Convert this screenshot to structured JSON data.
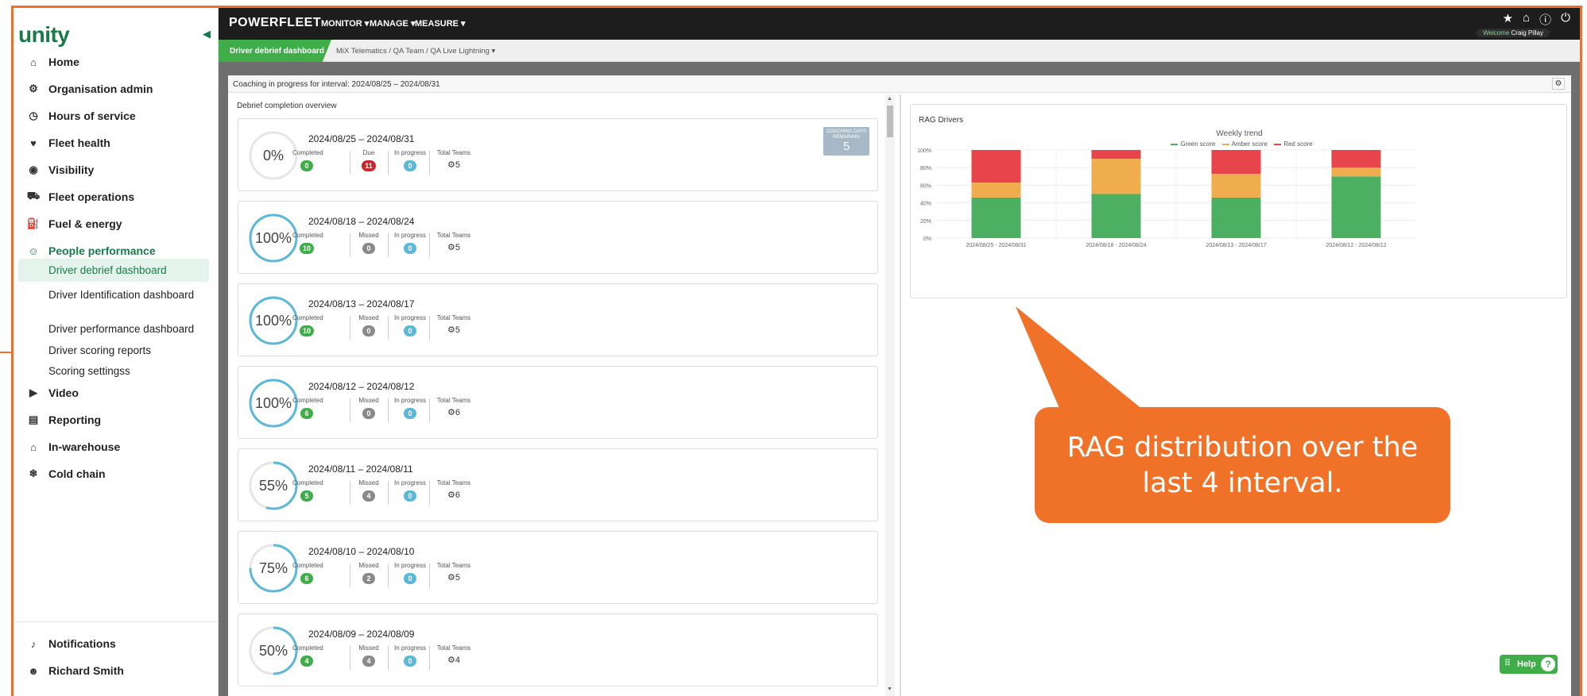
{
  "sidebar": {
    "logo": "unity",
    "items": [
      {
        "label": "Home",
        "icon": "home-icon"
      },
      {
        "label": "Organisation admin",
        "icon": "org-admin-icon"
      },
      {
        "label": "Hours of service",
        "icon": "hours-icon"
      },
      {
        "label": "Fleet health",
        "icon": "fleet-health-icon"
      },
      {
        "label": "Visibility",
        "icon": "visibility-icon"
      },
      {
        "label": "Fleet operations",
        "icon": "vehicle-icon"
      },
      {
        "label": "Fuel & energy",
        "icon": "fuel-icon"
      },
      {
        "label": "People performance",
        "icon": "people-icon"
      }
    ],
    "sub_items": [
      {
        "label": "Driver debrief dashboard"
      },
      {
        "label": "Driver Identification dashboard"
      },
      {
        "label": "Driver performance dashboard"
      },
      {
        "label": "Driver scoring reports"
      },
      {
        "label": "Scoring settingss"
      }
    ],
    "items_after": [
      {
        "label": "Video",
        "icon": "video-icon"
      },
      {
        "label": "Reporting",
        "icon": "reporting-icon"
      },
      {
        "label": "In-warehouse",
        "icon": "warehouse-icon"
      },
      {
        "label": "Cold chain",
        "icon": "snowflake-icon"
      }
    ],
    "bottom": [
      {
        "label": "Notifications",
        "icon": "bell-icon"
      },
      {
        "label": "Richard Smith",
        "icon": "user-icon"
      }
    ]
  },
  "topbar": {
    "brand": "POWERFLEET",
    "menus": [
      "MONITOR ▾",
      "MANAGE ▾",
      "MEASURE ▾"
    ],
    "welcome": "Welcome",
    "user": "Craig Pillay"
  },
  "breadcrumb": {
    "active": "Driver debrief dashboard",
    "path": "MiX Telematics  /  QA Team  /  QA Live Lightning  ▾"
  },
  "panel": {
    "header_label": "Coaching in progress for interval:",
    "header_value": "2024/08/25 – 2024/08/31",
    "overview_title": "Debrief completion overview"
  },
  "cards": [
    {
      "percent": 0,
      "pct_label": "0%",
      "period": "2024/08/25 – 2024/08/31",
      "completed": "0",
      "second_label": "Due",
      "second": "11",
      "second_color": "red",
      "in_progress": "0",
      "teams": "5",
      "badge": true
    },
    {
      "percent": 100,
      "pct_label": "100%",
      "period": "2024/08/18 – 2024/08/24",
      "completed": "10",
      "second_label": "Missed",
      "second": "0",
      "second_color": "grey",
      "in_progress": "0",
      "teams": "5"
    },
    {
      "percent": 100,
      "pct_label": "100%",
      "period": "2024/08/13 – 2024/08/17",
      "completed": "10",
      "second_label": "Missed",
      "second": "0",
      "second_color": "grey",
      "in_progress": "0",
      "teams": "5"
    },
    {
      "percent": 100,
      "pct_label": "100%",
      "period": "2024/08/12 – 2024/08/12",
      "completed": "6",
      "second_label": "Missed",
      "second": "0",
      "second_color": "grey",
      "in_progress": "0",
      "teams": "6"
    },
    {
      "percent": 55,
      "pct_label": "55%",
      "period": "2024/08/11 – 2024/08/11",
      "completed": "5",
      "second_label": "Missed",
      "second": "4",
      "second_color": "grey",
      "in_progress": "0",
      "teams": "6"
    },
    {
      "percent": 75,
      "pct_label": "75%",
      "period": "2024/08/10 – 2024/08/10",
      "completed": "6",
      "second_label": "Missed",
      "second": "2",
      "second_color": "grey",
      "in_progress": "0",
      "teams": "5"
    },
    {
      "percent": 50,
      "pct_label": "50%",
      "period": "2024/08/09 – 2024/08/09",
      "completed": "4",
      "second_label": "Missed",
      "second": "4",
      "second_color": "grey",
      "in_progress": "0",
      "teams": "4"
    }
  ],
  "labels": {
    "completed": "Completed",
    "in_progress": "In progress",
    "total_teams": "Total Teams",
    "coaching_days": "COACHING DAYS REMAINING",
    "coaching_days_value": "5"
  },
  "colors": {
    "accent": "#3fae49",
    "callout": "#f07128",
    "green": "#4caf61",
    "amber": "#f0ad4e",
    "red": "#e8444c",
    "ring": "#5bb8d8"
  },
  "chart_data": {
    "type": "bar",
    "stacked": true,
    "title": "RAG Drivers",
    "subtitle": "Weekly trend",
    "categories": [
      "2024/08/25 - 2024/08/31",
      "2024/08/18 - 2024/08/24",
      "2024/08/13 - 2024/08/17",
      "2024/08/12 - 2024/08/12"
    ],
    "series": [
      {
        "name": "Green score",
        "color": "#4caf61",
        "values": [
          46,
          50,
          46,
          70
        ]
      },
      {
        "name": "Amber score",
        "color": "#f0ad4e",
        "values": [
          17,
          40,
          27,
          10
        ]
      },
      {
        "name": "Red score",
        "color": "#e8444c",
        "values": [
          37,
          10,
          27,
          20
        ]
      }
    ],
    "y_ticks": [
      "0%",
      "20%",
      "40%",
      "60%",
      "80%",
      "100%"
    ],
    "ylim": [
      0,
      100
    ],
    "legend": "top-center",
    "grid": true
  },
  "callout": {
    "line1": "RAG distribution over the",
    "line2": "last 4 interval."
  },
  "help": {
    "label": "Help",
    "q": "?"
  }
}
